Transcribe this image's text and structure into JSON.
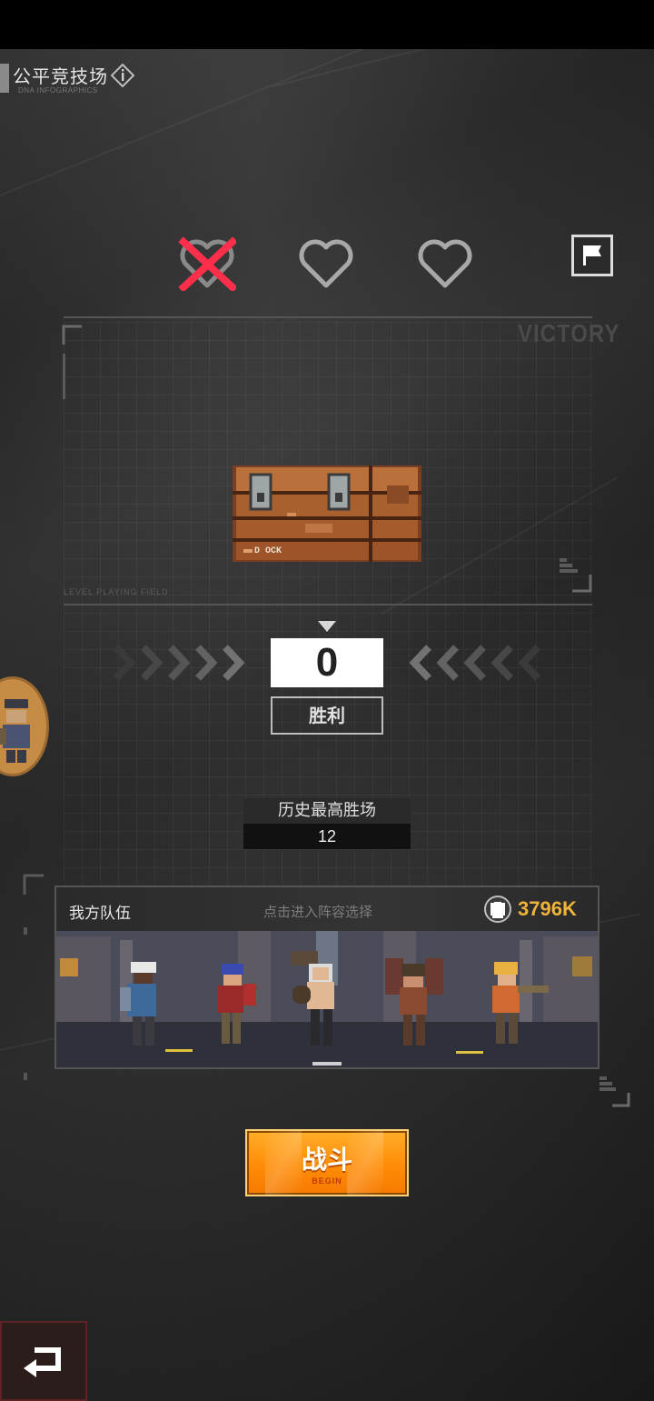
{
  "header": {
    "title": "公平竞技场",
    "subtitle": "DNA INFOGRAPHICS"
  },
  "lives": {
    "total": 3,
    "lost": 1
  },
  "banner": {
    "victory_text": "VICTORY",
    "field_text": "LEVEL PLAYING FIELD",
    "chest_text": "D OCK"
  },
  "score": {
    "wins": "0",
    "label": "胜利"
  },
  "record": {
    "label": "历史最高胜场",
    "value": "12"
  },
  "team": {
    "title": "我方队伍",
    "hint": "点击进入阵容选择",
    "power": "3796K"
  },
  "battle_button": {
    "label": "战斗",
    "sub_label": "BEGIN"
  },
  "colors": {
    "accent_orange": "#ff8c07",
    "power_gold": "#f0b33a",
    "lost_life_red": "#ff2e4a",
    "back_button_border": "#5b2323"
  },
  "icons": {
    "info": "info-icon",
    "flag": "flag-icon",
    "power": "fist-icon",
    "back": "return-arrow-icon"
  }
}
